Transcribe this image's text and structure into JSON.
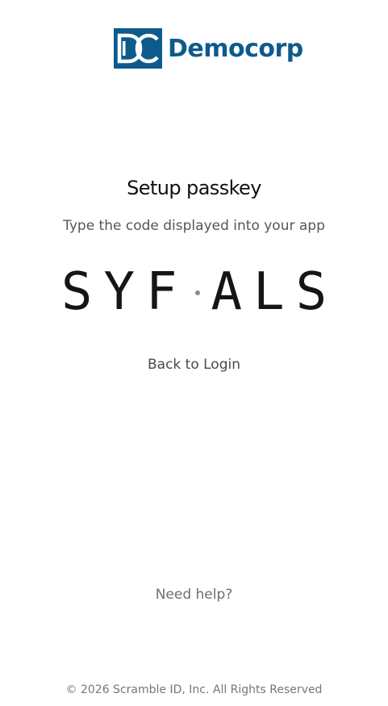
{
  "logo": {
    "brand_name": "Democorp",
    "brand_color": "#0d5b8c",
    "mark_letters": "DC"
  },
  "page": {
    "title": "Setup passkey",
    "subtitle": "Type the code displayed into your app"
  },
  "code": {
    "first_group": "SYF",
    "second_group": "ALS",
    "separator_icon": "dot"
  },
  "links": {
    "back_to_login": "Back to Login",
    "need_help": "Need help?"
  },
  "footer": {
    "copyright": "© 2026 Scramble ID, Inc. All Rights Reserved"
  }
}
